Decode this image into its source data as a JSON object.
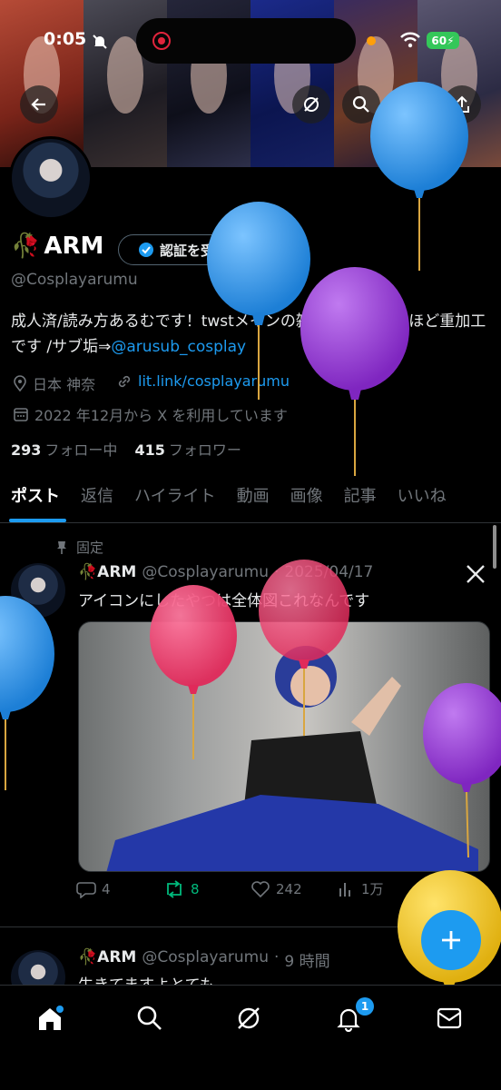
{
  "status_bar": {
    "time": "0:05",
    "battery": "60"
  },
  "header": {
    "back_icon": "arrow-left-icon",
    "grok_icon": "grok-icon",
    "search_icon": "search-icon",
    "share_icon": "share-icon"
  },
  "profile": {
    "emoji": "🥀",
    "display_name": "ARM",
    "verify_label": "認証を受ける",
    "handle": "@Cosplayarumu",
    "bio_text": "成人済/読み方あるむです！twstメインの雑多垢 超がつくほど重加工です /サブ垢⇒",
    "bio_link": "@arusub_cosplay",
    "location": "日本 神奈",
    "website": "lit.link/cosplayarumu",
    "joined": "2022 年12月から X を利用しています",
    "following_count": "293",
    "following_label": "フォロー中",
    "followers_count": "415",
    "followers_label": "フォロワー"
  },
  "tabs": [
    "ポスト",
    "返信",
    "ハイライト",
    "動画",
    "画像",
    "記事",
    "いいね"
  ],
  "pinned_label": "固定",
  "posts": [
    {
      "name": "ARM",
      "handle": "@Cosplayarumu",
      "date": "2025/04/17",
      "text": "アイコンにしたやつは全体図これなんです",
      "replies": "4",
      "reposts": "8",
      "likes": "242",
      "views": "1万"
    },
    {
      "name": "ARM",
      "handle": "@Cosplayarumu",
      "date": "9 時間",
      "text": "生きてますよとても"
    }
  ],
  "nav": {
    "notifications_badge": "1"
  },
  "colors": {
    "accent": "#1d9bf0",
    "repost_green": "#00ba7c",
    "balloon_blue": "#2f8fe0",
    "balloon_purple": "#9a3fd0",
    "balloon_pink": "#ea3b6a",
    "balloon_yellow": "#f2c318"
  }
}
